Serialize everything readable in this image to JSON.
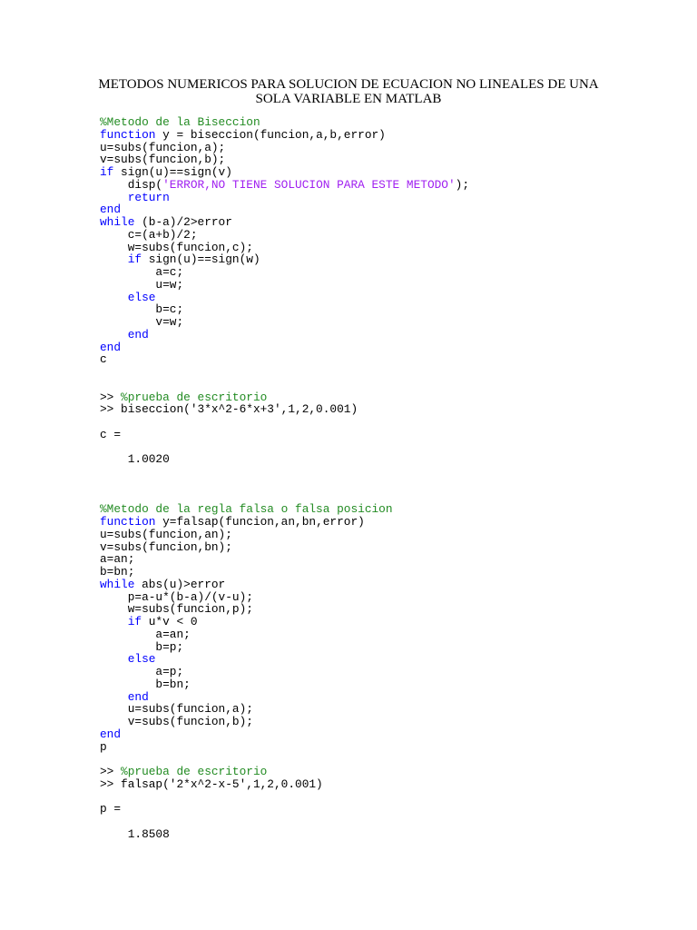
{
  "document": {
    "title_lines": [
      "METODOS NUMERICOS PARA SOLUCION DE ECUACION NO LINEALES DE UNA",
      "SOLA VARIABLE EN MATLAB"
    ],
    "colors": {
      "keyword": "#0000ff",
      "comment": "#228b22",
      "string": "#a020f0",
      "text": "#000000"
    },
    "code_lines": [
      [
        [
          "cm",
          "%Metodo de la Biseccion"
        ]
      ],
      [
        [
          "kw",
          "function"
        ],
        [
          "",
          " y = biseccion(funcion,a,b,error)"
        ]
      ],
      [
        [
          "",
          "u=subs(funcion,a);"
        ]
      ],
      [
        [
          "",
          "v=subs(funcion,b);"
        ]
      ],
      [
        [
          "kw",
          "if"
        ],
        [
          "",
          " sign(u)==sign(v)"
        ]
      ],
      [
        [
          "",
          "    disp("
        ],
        [
          "st",
          "'ERROR,NO TIENE SOLUCION PARA ESTE METODO'"
        ],
        [
          "",
          ");"
        ]
      ],
      [
        [
          "",
          "    "
        ],
        [
          "kw",
          "return"
        ]
      ],
      [
        [
          "kw",
          "end"
        ]
      ],
      [
        [
          "kw",
          "while"
        ],
        [
          "",
          " (b-a)/2>error"
        ]
      ],
      [
        [
          "",
          "    c=(a+b)/2;"
        ]
      ],
      [
        [
          "",
          "    w=subs(funcion,c);"
        ]
      ],
      [
        [
          "",
          "    "
        ],
        [
          "kw",
          "if"
        ],
        [
          "",
          " sign(u)==sign(w)"
        ]
      ],
      [
        [
          "",
          "        a=c;"
        ]
      ],
      [
        [
          "",
          "        u=w;"
        ]
      ],
      [
        [
          "",
          "    "
        ],
        [
          "kw",
          "else"
        ]
      ],
      [
        [
          "",
          "        b=c;"
        ]
      ],
      [
        [
          "",
          "        v=w;"
        ]
      ],
      [
        [
          "",
          "    "
        ],
        [
          "kw",
          "end"
        ]
      ],
      [
        [
          "kw",
          "end"
        ]
      ],
      [
        [
          "",
          "c"
        ]
      ],
      [],
      [],
      [
        [
          "",
          ">> "
        ],
        [
          "cm",
          "%prueba de escritorio"
        ]
      ],
      [
        [
          "",
          ">> biseccion('3*x^2-6*x+3',1,2,0.001)"
        ]
      ],
      [],
      [
        [
          "",
          "c ="
        ]
      ],
      [],
      [
        [
          "",
          "    1.0020"
        ]
      ],
      [],
      [],
      [],
      [
        [
          "cm",
          "%Metodo de la regla falsa o falsa posicion"
        ]
      ],
      [
        [
          "kw",
          "function"
        ],
        [
          "",
          " y=falsap(funcion,an,bn,error)"
        ]
      ],
      [
        [
          "",
          "u=subs(funcion,an);"
        ]
      ],
      [
        [
          "",
          "v=subs(funcion,bn);"
        ]
      ],
      [
        [
          "",
          "a=an;"
        ]
      ],
      [
        [
          "",
          "b=bn;"
        ]
      ],
      [
        [
          "kw",
          "while"
        ],
        [
          "",
          " abs(u)>error"
        ]
      ],
      [
        [
          "",
          "    p=a-u*(b-a)/(v-u);"
        ]
      ],
      [
        [
          "",
          "    w=subs(funcion,p);"
        ]
      ],
      [
        [
          "",
          "    "
        ],
        [
          "kw",
          "if"
        ],
        [
          "",
          " u*v < 0"
        ]
      ],
      [
        [
          "",
          "        a=an;"
        ]
      ],
      [
        [
          "",
          "        b=p;"
        ]
      ],
      [
        [
          "",
          "    "
        ],
        [
          "kw",
          "else"
        ]
      ],
      [
        [
          "",
          "        a=p;"
        ]
      ],
      [
        [
          "",
          "        b=bn;"
        ]
      ],
      [
        [
          "",
          "    "
        ],
        [
          "kw",
          "end"
        ]
      ],
      [
        [
          "",
          "    u=subs(funcion,a);"
        ]
      ],
      [
        [
          "",
          "    v=subs(funcion,b);"
        ]
      ],
      [
        [
          "kw",
          "end"
        ]
      ],
      [
        [
          "",
          "p"
        ]
      ],
      [],
      [
        [
          "",
          ">> "
        ],
        [
          "cm",
          "%prueba de escritorio"
        ]
      ],
      [
        [
          "",
          ">> falsap('2*x^2-x-5',1,2,0.001)"
        ]
      ],
      [],
      [
        [
          "",
          "p ="
        ]
      ],
      [],
      [
        [
          "",
          "    1.8508"
        ]
      ]
    ]
  }
}
